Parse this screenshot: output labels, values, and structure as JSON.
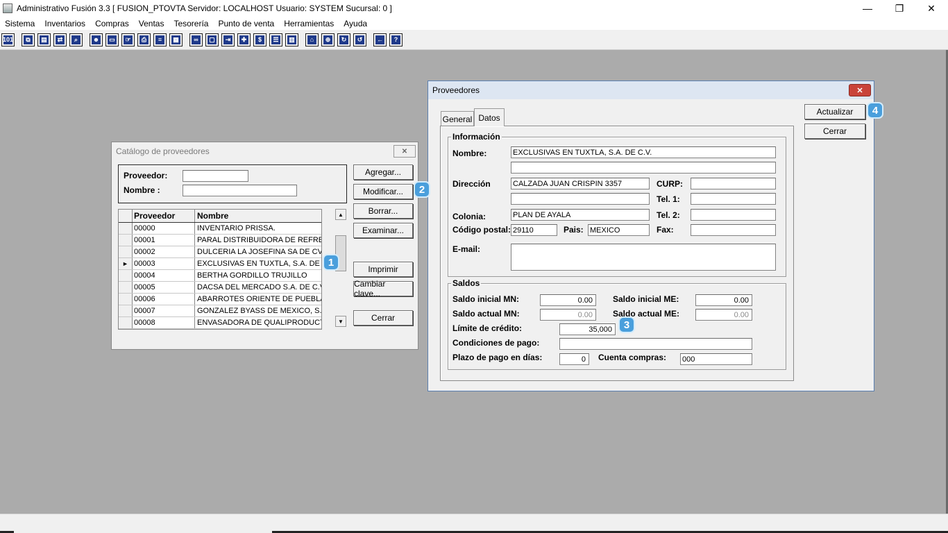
{
  "app": {
    "title": "Administrativo Fusión 3.3 [ FUSION_PTOVTA   Servidor: LOCALHOST   Usuario: SYSTEM     Sucursal: 0 ]",
    "window_controls": {
      "minimize": "—",
      "restore": "❐",
      "close": "✕"
    }
  },
  "menu": [
    "Sistema",
    "Inventarios",
    "Compras",
    "Ventas",
    "Tesorería",
    "Punto de venta",
    "Herramientas",
    "Ayuda"
  ],
  "toolbar_icons": [
    "1:01-icon",
    "copy-icon",
    "clipboard-icon",
    "swap-icon",
    "search-doc-icon",
    "user-icon",
    "folder-icon",
    "hand-doc-icon",
    "printer-icon",
    "document-icon",
    "table-icon",
    "binoculars-icon",
    "window-icon",
    "export-icon",
    "plus-icon",
    "dollar-icon",
    "list-icon",
    "notes-icon",
    "home-icon",
    "zoom-icon",
    "refresh-icon",
    "undo-icon",
    "back-icon",
    "help-icon"
  ],
  "catalog": {
    "title": "Catálogo de proveedores",
    "close_glyph": "✕",
    "filter_proveedor_label": "Proveedor:",
    "filter_nombre_label": "Nombre :",
    "filter_proveedor_value": "",
    "filter_nombre_value": "",
    "columns": [
      "Proveedor",
      "Nombre"
    ],
    "rows": [
      {
        "id": "00000",
        "name": "INVENTARIO PRISSA.",
        "marker": ""
      },
      {
        "id": "00001",
        "name": "PARAL DISTRIBUIDORA DE REFRESC",
        "marker": ""
      },
      {
        "id": "00002",
        "name": "DULCERIA LA JOSEFINA SA DE CV",
        "marker": ""
      },
      {
        "id": "00003",
        "name": "EXCLUSIVAS EN TUXTLA, S.A. DE C.",
        "marker": "►"
      },
      {
        "id": "00004",
        "name": "BERTHA GORDILLO TRUJILLO",
        "marker": ""
      },
      {
        "id": "00005",
        "name": "DACSA DEL MERCADO S.A. DE C.V.",
        "marker": ""
      },
      {
        "id": "00006",
        "name": "ABARROTES ORIENTE DE PUEBLA, S",
        "marker": ""
      },
      {
        "id": "00007",
        "name": "GONZALEZ BYASS DE MEXICO, S.A.",
        "marker": ""
      },
      {
        "id": "00008",
        "name": "ENVASADORA DE QUALIPRODUCTO",
        "marker": ""
      }
    ],
    "scroll_up": "▲",
    "scroll_down": "▼",
    "buttons": {
      "agregar": "Agregar...",
      "modificar": "Modificar...",
      "borrar": "Borrar...",
      "examinar": "Examinar...",
      "imprimir": "Imprimir",
      "cambiar_clave": "Cambiar clave...",
      "cerrar": "Cerrar"
    }
  },
  "proveedores": {
    "title": "Proveedores",
    "close_glyph": "✕",
    "tabs": [
      "General",
      "Datos"
    ],
    "informacion": {
      "title": "Información",
      "nombre_label": "Nombre:",
      "nombre": "EXCLUSIVAS EN TUXTLA, S.A. DE C.V.",
      "nombre2": "",
      "direccion_label": "Dirección",
      "direccion": "CALZADA JUAN CRISPIN 3357",
      "direccion2": "",
      "curp_label": "CURP:",
      "curp": "",
      "tel1_label": "Tel. 1:",
      "tel1": "",
      "colonia_label": "Colonia:",
      "colonia": "PLAN DE AYALA",
      "tel2_label": "Tel. 2:",
      "tel2": "",
      "cp_label": "Código postal:",
      "cp": "29110",
      "pais_label": "Pais:",
      "pais": "MEXICO",
      "fax_label": "Fax:",
      "fax": "",
      "email_label": "E-mail:",
      "email": ""
    },
    "saldos": {
      "title": "Saldos",
      "saldo_inicial_mn_label": "Saldo inicial MN:",
      "saldo_inicial_mn": "0.00",
      "saldo_inicial_me_label": "Saldo inicial ME:",
      "saldo_inicial_me": "0.00",
      "saldo_actual_mn_label": "Saldo actual MN:",
      "saldo_actual_mn": "0.00",
      "saldo_actual_me_label": "Saldo actual ME:",
      "saldo_actual_me": "0.00",
      "limite_label": "Límite de crédito:",
      "limite": "35,000",
      "condiciones_label": "Condiciones de pago:",
      "condiciones": "",
      "plazo_label": "Plazo de pago en días:",
      "plazo": "0",
      "cuenta_label": "Cuenta compras:",
      "cuenta": "000"
    },
    "buttons": {
      "actualizar": "Actualizar",
      "cerrar": "Cerrar"
    }
  },
  "badges": [
    "1",
    "2",
    "3",
    "4"
  ]
}
